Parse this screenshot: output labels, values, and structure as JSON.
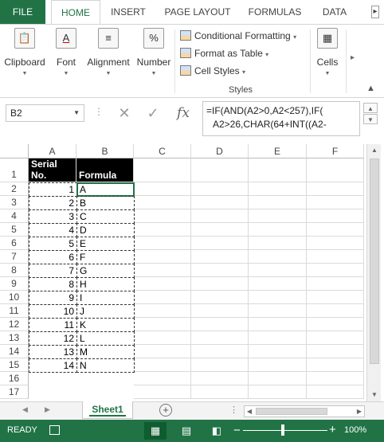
{
  "ribbon": {
    "tabs": [
      "FILE",
      "HOME",
      "INSERT",
      "PAGE LAYOUT",
      "FORMULAS",
      "DATA"
    ],
    "active_tab": "HOME",
    "groups": {
      "clipboard": "Clipboard",
      "font": "Font",
      "alignment": "Alignment",
      "number": "Number",
      "cells": "Cells",
      "styles": "Styles"
    },
    "styles_items": [
      "Conditional Formatting",
      "Format as Table",
      "Cell Styles"
    ],
    "number_glyph": "%"
  },
  "formula_bar": {
    "name_box": "B2",
    "fx": "fx",
    "formula_line1": "=IF(AND(A2>0,A2<257),IF(",
    "formula_line2": "A2>26,CHAR(64+INT((A2-"
  },
  "grid": {
    "columns": [
      "A",
      "B",
      "C",
      "D",
      "E",
      "F"
    ],
    "rows": [
      "1",
      "2",
      "3",
      "4",
      "5",
      "6",
      "7",
      "8",
      "9",
      "10",
      "11",
      "12",
      "13",
      "14",
      "15",
      "16",
      "17"
    ],
    "header": {
      "a1_line1": "Serial",
      "a1_line2": "No.",
      "b1": "Formula"
    },
    "serial": [
      "1",
      "2",
      "3",
      "4",
      "5",
      "6",
      "7",
      "8",
      "9",
      "10",
      "11",
      "12",
      "13",
      "14"
    ],
    "formula": [
      "A",
      "B",
      "C",
      "D",
      "E",
      "F",
      "G",
      "H",
      "I",
      "J",
      "K",
      "L",
      "M",
      "N"
    ]
  },
  "sheets": {
    "active": "Sheet1"
  },
  "status": {
    "mode": "READY",
    "zoom": "100%"
  },
  "colors": {
    "excel_green": "#217346",
    "header_fill": "#000000"
  }
}
